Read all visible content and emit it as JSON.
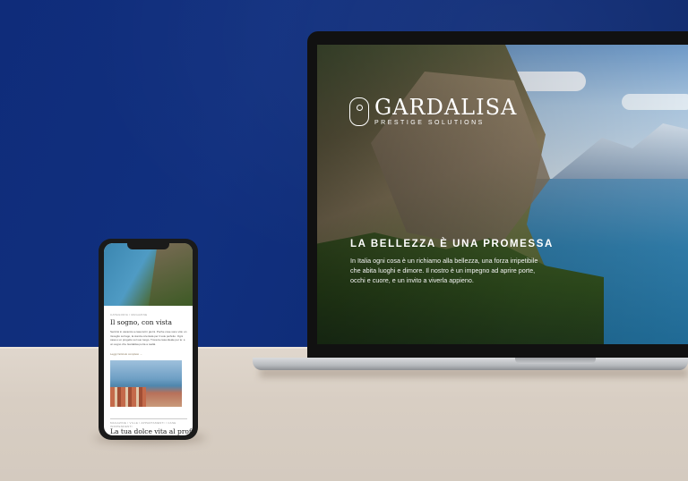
{
  "laptop_site": {
    "brand": "GARDALISA",
    "brand_sub": "PRESTIGE SOLUTIONS",
    "headline": "LA BELLEZZA È UNA PROMESSA",
    "body": "In Italia ogni cosa è un richiamo alla bellezza, una forza irripetibile che abita luoghi e dimore. Il nostro è un impegno ad aprire porte, occhi e cuore, e un invito a viverla appieno."
  },
  "phone_site": {
    "category1": "CATEGORIA / MAGAZINE",
    "title1": "Il sogno, con vista",
    "body1": "Sentirsi in vacanza a casa tutti i giorni. Poche cose sono vita: un risveglio sul lago, la stanza orientata per il sole perfetto. Ogni casa è un progetto sul suo luogo. Trova la casa ideale per te: è un sogno che Gardalisa porta a realtà.",
    "link1": "Leggi l’articolo completo →",
    "category2": "MAGAZINE / VILLE / APPARTAMENTI / CASE INDIPENDENTI",
    "title2": "La tua dolce vita al profumo di"
  },
  "colors": {
    "wall": "#0f2c7a",
    "table": "#d8cec3"
  }
}
